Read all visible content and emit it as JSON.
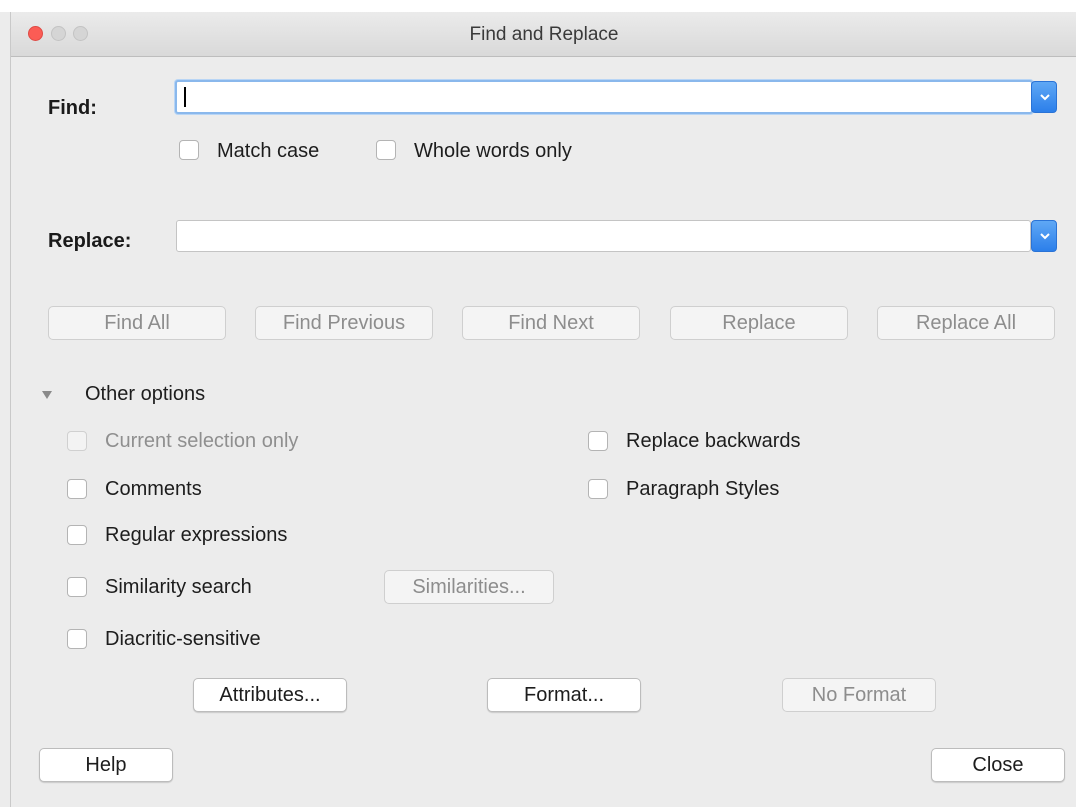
{
  "window": {
    "title": "Find and Replace"
  },
  "find": {
    "label": "Find:",
    "value": ""
  },
  "options_row": {
    "match_case": "Match case",
    "whole_words": "Whole words only"
  },
  "replace": {
    "label": "Replace:",
    "value": ""
  },
  "actions": {
    "find_all": "Find All",
    "find_previous": "Find Previous",
    "find_next": "Find Next",
    "replace": "Replace",
    "replace_all": "Replace All"
  },
  "other_options": {
    "label": "Other options",
    "expanded": true,
    "current_selection_only": "Current selection only",
    "comments": "Comments",
    "regular_expressions": "Regular expressions",
    "similarity_search": "Similarity search",
    "similarities_button": "Similarities...",
    "diacritic_sensitive": "Diacritic-sensitive",
    "replace_backwards": "Replace backwards",
    "paragraph_styles": "Paragraph Styles"
  },
  "format_buttons": {
    "attributes": "Attributes...",
    "format": "Format...",
    "no_format": "No Format"
  },
  "footer": {
    "help": "Help",
    "close": "Close"
  },
  "colors": {
    "accent": "#2c7fea",
    "close_light": "#fb5c55",
    "focus_ring": "#8ab8ec"
  }
}
